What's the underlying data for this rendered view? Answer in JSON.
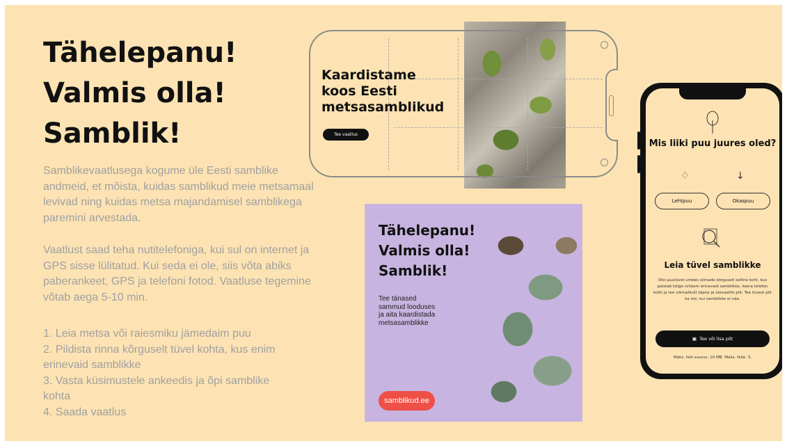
{
  "headline": [
    "Tähelepanu!",
    "Valmis olla!",
    "Samblik!"
  ],
  "paragraphs": [
    "Samblikevaatlusega kogume üle Eesti samblike andmeid, et mõista, kuidas samblikud meie metsamaal levivad ning kuidas metsa majandamisel samblikega paremini arvestada.",
    "Vaatlust saad teha nutitelefoniga, kui sul on internet ja GPS sisse lülitatud. Kui seda ei ole, siis võta abiks paberankeet, GPS ja telefoni fotod. Vaatluse tegemine võtab aega 5-10 min."
  ],
  "steps": [
    "1. Leia metsa või raiesmiku jämedaim puu",
    "2. Pildista rinna kõrguselt tüvel kohta, kus enim",
    "erinevaid samblikke",
    "3. Vasta küsimustele ankeedis ja õpi samblike",
    "kohta",
    "4. Saada vaatlus"
  ],
  "landscape_phone": {
    "title": [
      "Kaardistame",
      "koos Eesti",
      "metsasamblikud"
    ],
    "button": "Tee vaatlus"
  },
  "poster": {
    "title": [
      "Tähelepanu!",
      "Valmis olla!",
      "Samblik!"
    ],
    "text": [
      "Tee tänased",
      "sammud looduses",
      "ja aita kaardistada",
      "metsasamblikke"
    ],
    "button": "samblikud.ee"
  },
  "portrait_phone": {
    "question": "Mis liiki puu juures oled?",
    "choices": [
      "Lehtpuu",
      "Okaspuu"
    ],
    "find_title": "Leia tüvel samblikke",
    "find_text": "Otsi puutüvel umbes silmade kõrguselt selline koht, kus paistab kõige rohkem erinevaid samblikke, keera telefon külili ja tee võimalikult täpne ja ülevaatlik pilt. Tee tüvest pilt ka siis, kui samblikke ei näe.",
    "photo_button": "Tee või lisa pilt",
    "max_text": "Maks. faili suurus: 10 MB. Maks. faile: 3."
  },
  "colors": {
    "background": "#fde3b3",
    "poster_background": "#c7b4e0",
    "accent_red": "#ef4f46",
    "text_dark": "#111111",
    "text_muted": "#a0a0a0"
  }
}
